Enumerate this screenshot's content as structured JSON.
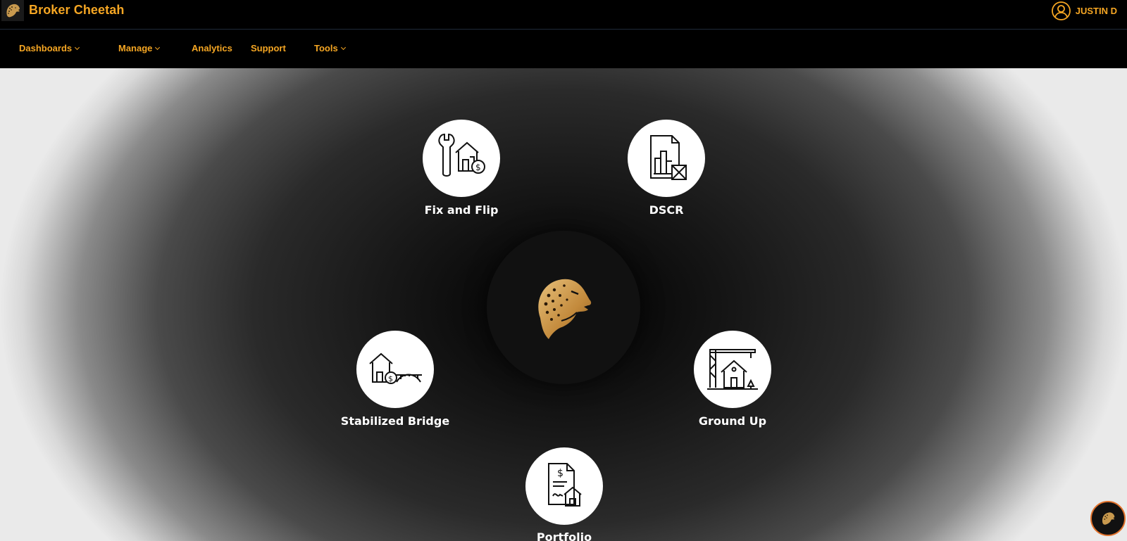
{
  "header": {
    "brand_name": "Broker Cheetah",
    "user_name": "JUSTIN D"
  },
  "nav": {
    "items": [
      {
        "label": "Dashboards",
        "has_dropdown": true
      },
      {
        "label": "Manage",
        "has_dropdown": true
      },
      {
        "label": "Analytics",
        "has_dropdown": false
      },
      {
        "label": "Support",
        "has_dropdown": false
      },
      {
        "label": "Tools",
        "has_dropdown": true
      }
    ]
  },
  "products": [
    {
      "label": "Fix and Flip",
      "icon": "fix-and-flip-icon"
    },
    {
      "label": "DSCR",
      "icon": "dscr-icon"
    },
    {
      "label": "Stabilized Bridge",
      "icon": "stabilized-bridge-icon"
    },
    {
      "label": "Ground Up",
      "icon": "ground-up-icon"
    },
    {
      "label": "Portfolio",
      "icon": "portfolio-icon"
    }
  ],
  "colors": {
    "accent": "#f5a623",
    "background": "#000000",
    "node_fill": "#ffffff",
    "label_text": "#ffffff"
  }
}
